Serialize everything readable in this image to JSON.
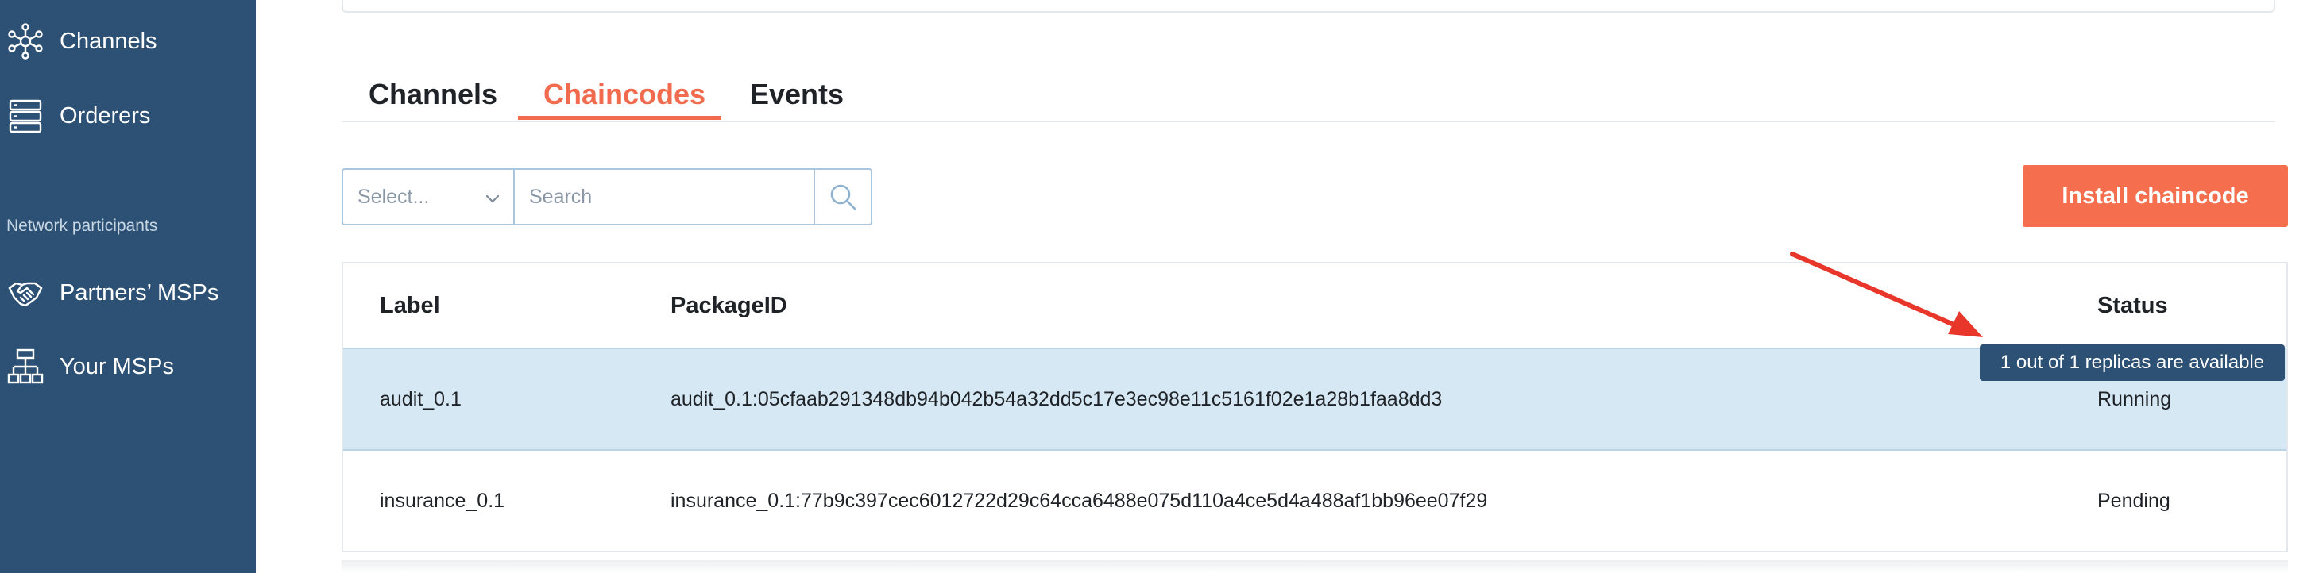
{
  "sidebar": {
    "items": [
      {
        "label": "Channels",
        "icon": "network-icon"
      },
      {
        "label": "Orderers",
        "icon": "server-icon"
      }
    ],
    "section_title": "Network participants",
    "participants": [
      {
        "label": "Partners’ MSPs",
        "icon": "handshake-icon"
      },
      {
        "label": "Your MSPs",
        "icon": "org-chart-icon"
      }
    ]
  },
  "tabs": [
    {
      "label": "Channels",
      "active": false
    },
    {
      "label": "Chaincodes",
      "active": true
    },
    {
      "label": "Events",
      "active": false
    }
  ],
  "filter": {
    "select_value": "Select...",
    "search_placeholder": "Search"
  },
  "actions": {
    "install_label": "Install chaincode"
  },
  "table": {
    "headers": [
      "Label",
      "PackageID",
      "Status"
    ],
    "rows": [
      {
        "label": "audit_0.1",
        "package_id": "audit_0.1:05cfaab291348db94b042b54a32dd5c17e3ec98e11c5161f02e1a28b1faa8dd3",
        "status": "Running"
      },
      {
        "label": "insurance_0.1",
        "package_id": "insurance_0.1:77b9c397cec6012722d29c64cca6488e075d110a4ce5d4a488af1bb96ee07f29",
        "status": "Pending"
      }
    ]
  },
  "tooltip": {
    "text": "1 out of 1 replicas are available"
  },
  "colors": {
    "sidebar": "#2c5175",
    "accent": "#f26b4e",
    "selected_row": "#d6e8f3",
    "annotation_arrow": "#e8362a"
  }
}
